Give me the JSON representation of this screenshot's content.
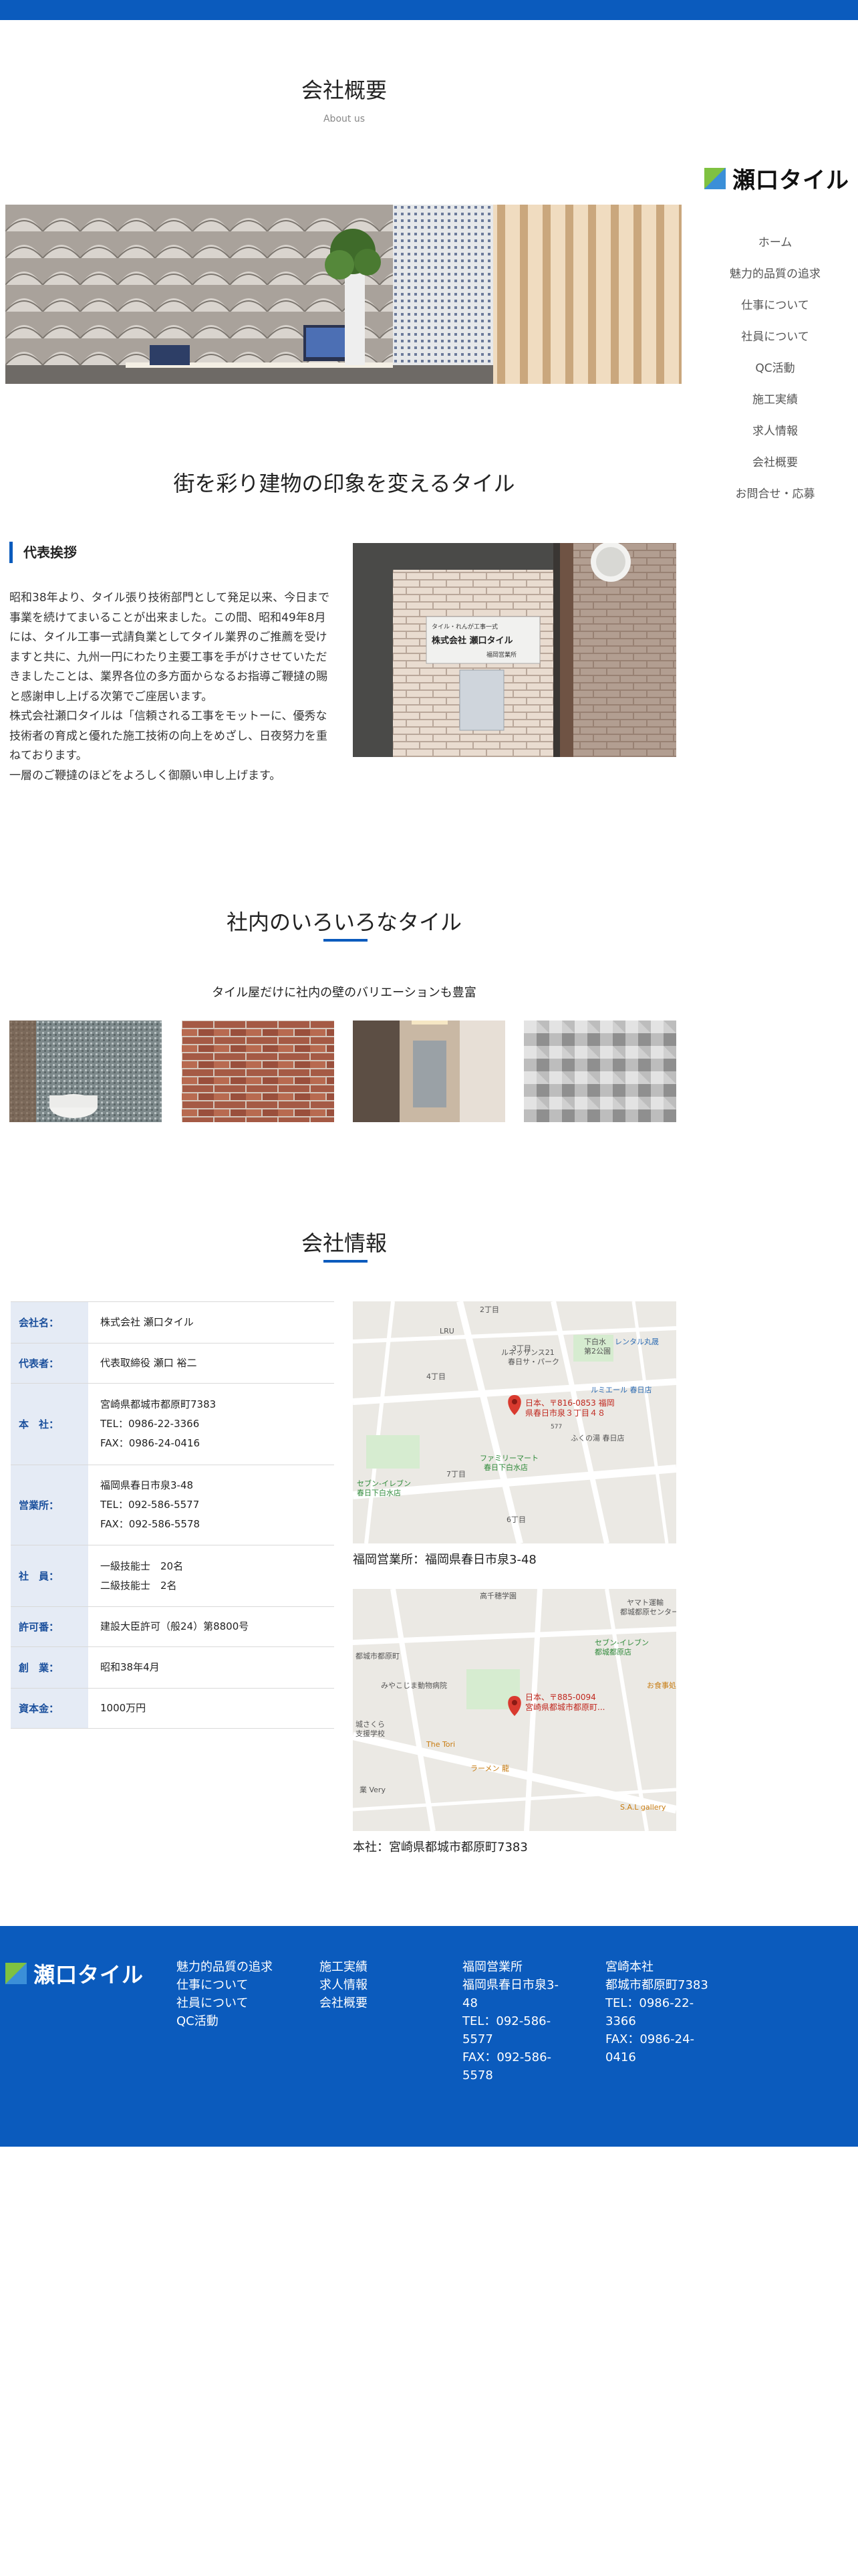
{
  "header": {
    "title": "会社概要",
    "subtitle": "About us"
  },
  "brand": {
    "logo_text": "瀬口タイル"
  },
  "nav": {
    "items": [
      {
        "label": "ホーム"
      },
      {
        "label": "魅力的品質の追求"
      },
      {
        "label": "仕事について"
      },
      {
        "label": "社員について"
      },
      {
        "label": "QC活動"
      },
      {
        "label": "施工実績"
      },
      {
        "label": "求人情報"
      },
      {
        "label": "会社概要"
      },
      {
        "label": "お問合せ・応募"
      }
    ]
  },
  "hero": {
    "catch": "街を彩り建物の印象を変えるタイル"
  },
  "sign": {
    "line1": "タイル・れんが工事一式",
    "line2": "株式会社 瀬口タイル",
    "line3": "福岡営業所"
  },
  "greeting": {
    "title": "代表挨拶",
    "paragraphs": [
      "昭和38年より、タイル張り技術部門として発足以来、今日まで事業を続けてまいることが出来ました。この間、昭和49年8月には、タイル工事一式請負業としてタイル業界のご推薦を受けますと共に、九州一円にわたり主要工事を手がけさせていただきましたことは、業界各位の多方面からなるお指導ご鞭撻の賜と感謝申し上げる次第でご座居います。",
      "株式会社瀬口タイルは「信頼される工事をモットーに、優秀な技術者の育成と優れた施工技術の向上をめざし、日夜努力を重ねております。",
      "一層のご鞭撻のほどをよろしく御願い申し上げます。"
    ]
  },
  "tiles": {
    "title": "社内のいろいろなタイル",
    "lead": "タイル屋だけに社内の壁のバリエーションも豊富"
  },
  "company": {
    "title": "会社情報",
    "rows": [
      {
        "key": "会社名：",
        "lines": [
          "株式会社 瀬口タイル"
        ]
      },
      {
        "key": "代表者：",
        "lines": [
          "代表取締役 瀬口 裕二"
        ]
      },
      {
        "key": "本　社：",
        "lines": [
          "宮崎県都城市都原町7383",
          "TEL：0986-22-3366",
          "FAX：0986-24-0416"
        ]
      },
      {
        "key": "営業所：",
        "lines": [
          "福岡県春日市泉3-48",
          "TEL：092-586-5577",
          "FAX：092-586-5578"
        ]
      },
      {
        "key": "社　員：",
        "lines": [
          "一級技能士　20名",
          "二級技能士　2名"
        ]
      },
      {
        "key": "許可番：",
        "lines": [
          "建設大臣許可（般24）第8800号"
        ]
      },
      {
        "key": "創　業：",
        "lines": [
          "昭和38年4月"
        ]
      },
      {
        "key": "資本金：",
        "lines": [
          "1000万円"
        ]
      }
    ]
  },
  "maps": [
    {
      "caption": "福岡営業所：福岡県春日市泉3-48",
      "pin_line1": "日本、〒816-0853 福岡",
      "pin_line2": "県春日市泉３丁目４８",
      "labels": [
        "LRU",
        "ルネッサンス21",
        "春日サ・パーク",
        "下白水",
        "第2公園",
        "レンタル丸晟",
        "ルミエール 春日店",
        "ふくの湯 春日店",
        "ファミリーマート",
        "春日下白水店",
        "セブン-イレブン",
        "春日下白水店",
        "3丁目",
        "4丁目",
        "7丁目",
        "6丁目",
        "2丁目",
        "577"
      ]
    },
    {
      "caption": "本社：宮崎県都城市都原町7383",
      "pin_line1": "日本、〒885-0094",
      "pin_line2": "宮崎県都城市都原町...",
      "labels": [
        "高千穂学園",
        "ヤマト運輸",
        "都城都原センター",
        "セブン-イレブン",
        "都城都原店",
        "都城市都原町",
        "みやこじま動物病院",
        "ラーメン 龍",
        "The Tori",
        "S.A.L gallery",
        "業 Very",
        "城さくら",
        "支援学校",
        "お食事処"
      ]
    }
  ],
  "footer": {
    "col1": [
      "魅力的品質の追求",
      "仕事について",
      "社員について",
      "QC活動"
    ],
    "col2": [
      "施工実績",
      "求人情報",
      "会社概要"
    ],
    "col3": [
      "福岡営業所",
      "福岡県春日市泉3-",
      "48",
      "TEL：092-586-",
      "5577",
      "FAX：092-586-",
      "5578"
    ],
    "col4": [
      "宮崎本社",
      "都城市都原町7383",
      "TEL：0986-22-",
      "3366",
      "FAX：0986-24-",
      "0416"
    ]
  },
  "colors": {
    "brand_blue": "#0b5bbd",
    "table_key_bg": "#e5ebf5",
    "logo_green": "#7fc141",
    "logo_blue": "#3b8fd8"
  }
}
